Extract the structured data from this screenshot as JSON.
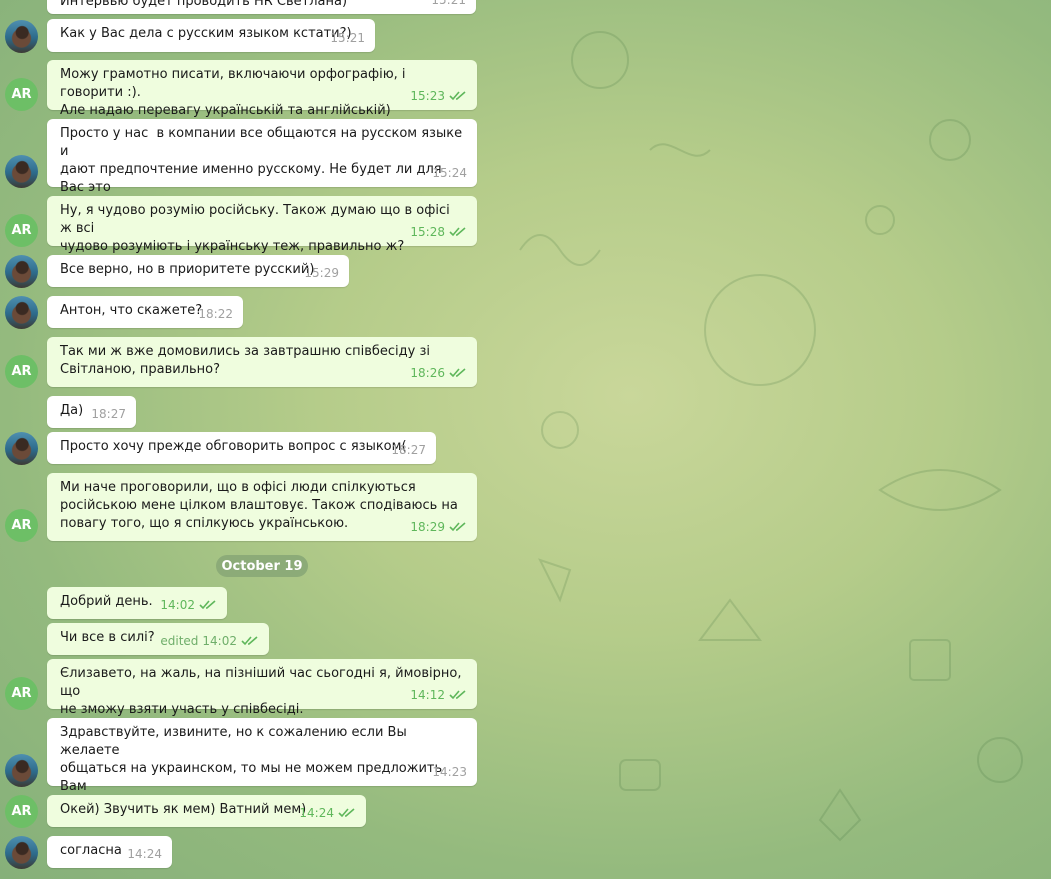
{
  "chat": {
    "date_separator": "October 19",
    "avatar_initials": "AR",
    "messages": [
      {
        "text": "Интервью будет проводить HR Светлана)",
        "time": "15:21",
        "edited": ""
      },
      {
        "text": "Как у Вас дела с русским языком кстати?)",
        "time": "15:21",
        "edited": ""
      },
      {
        "text": "Можу грамотно писати, включаючи орфографію, і говорити :).\nАле надаю перевагу українській та англійській)",
        "time": "15:23",
        "edited": ""
      },
      {
        "text": "Просто у нас  в компании все общаются на русском языке и\nдают предпочтение именно русскому. Не будет ли для Вас это\nпроблемой?",
        "time": "15:24",
        "edited": ""
      },
      {
        "text": "Ну, я чудово розумію російську. Також думаю що в офісі ж всі\nчудово розуміють і українську теж, правильно ж?",
        "time": "15:28",
        "edited": ""
      },
      {
        "text": "Все верно, но в приоритете русский)",
        "time": "15:29",
        "edited": ""
      },
      {
        "text": "Антон, что скажете?",
        "time": "18:22",
        "edited": ""
      },
      {
        "text": "Так ми ж вже домовились за завтрашню співбесіду зі\nСвітланою, правильно?",
        "time": "18:26",
        "edited": ""
      },
      {
        "text": "Да)",
        "time": "18:27",
        "edited": ""
      },
      {
        "text": "Просто хочу прежде обговорить вопрос с языком(",
        "time": "18:27",
        "edited": ""
      },
      {
        "text": "Ми наче проговорили, що в офісі люди спілкуються\nросійською мене цілком влаштовує. Також сподіваюсь на\nповагу того, що я спілкуюсь українською.",
        "time": "18:29",
        "edited": ""
      },
      {
        "text": "Добрий день.",
        "time": "14:02",
        "edited": ""
      },
      {
        "text": "Чи все в силі?",
        "time": "14:02",
        "edited": "edited"
      },
      {
        "text": "Єлизавето, на жаль, на пізніший час сьогодні я, ймовірно, що\nне зможу взяти участь у співбесіді.",
        "time": "14:12",
        "edited": ""
      },
      {
        "text": "Здравствуйте, извините, но к сожалению если Вы желаете\nобщаться на украинском, то мы не можем предложить Вам\nданную позицию",
        "time": "14:23",
        "edited": ""
      },
      {
        "text": "Окей) Звучить як мем) Ватний мем)",
        "time": "14:24",
        "edited": ""
      },
      {
        "text": "согласна",
        "time": "14:24",
        "edited": ""
      }
    ]
  },
  "colors": {
    "incoming_bubble": "#ffffff",
    "outgoing_bubble": "#effdde",
    "check_green": "#5fb75b",
    "avatar_green": "#6dbf66"
  }
}
